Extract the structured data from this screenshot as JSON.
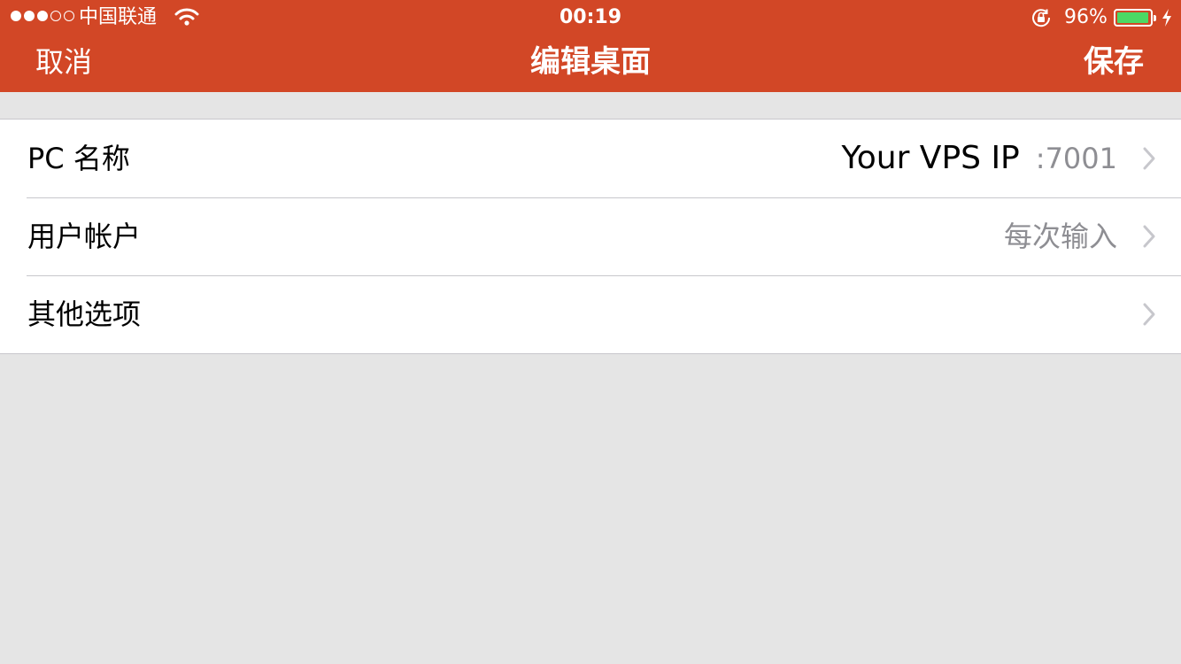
{
  "status_bar": {
    "carrier": "中国联通",
    "time": "00:19",
    "battery_percent": "96%",
    "battery_level": 0.96,
    "signal_bars_filled": 3,
    "signal_bars_total": 5,
    "icons": [
      "wifi-icon",
      "orientation-lock-icon",
      "battery-icon",
      "charging-bolt-icon"
    ]
  },
  "navbar": {
    "cancel_label": "取消",
    "title": "编辑桌面",
    "save_label": "保存"
  },
  "settings": {
    "rows": [
      {
        "label": "PC 名称",
        "value_primary": "Your VPS IP",
        "value_secondary": ":7001"
      },
      {
        "label": "用户帐户",
        "value": "每次输入"
      },
      {
        "label": "其他选项",
        "value": ""
      }
    ]
  },
  "colors": {
    "accent": "#d24726",
    "background": "#e5e5e5",
    "battery_fill": "#4cd964",
    "secondary_text": "#8e8e93"
  }
}
